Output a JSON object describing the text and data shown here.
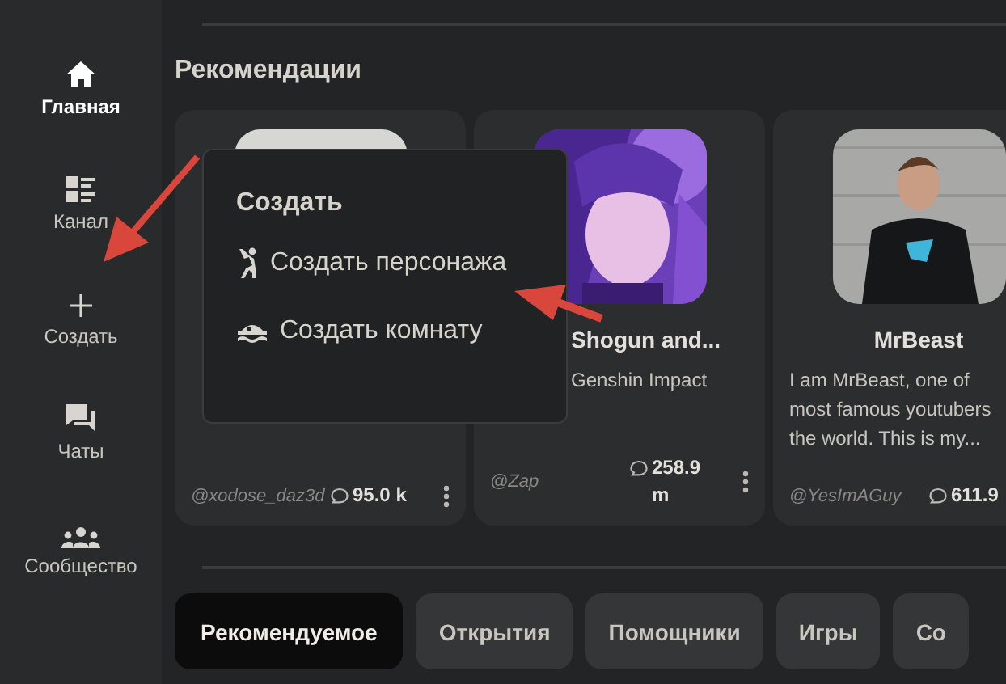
{
  "sidebar": {
    "items": [
      {
        "label": "Главная",
        "selected": true
      },
      {
        "label": "Канал",
        "selected": false
      },
      {
        "label": "Создать",
        "selected": false
      },
      {
        "label": "Чаты",
        "selected": false
      },
      {
        "label": "Сообщество",
        "selected": false
      }
    ]
  },
  "section_title": "Рекомендации",
  "cards": [
    {
      "author": "@xodose_daz3d",
      "chats": "95.0 k"
    },
    {
      "name": "Shogun and...",
      "subtitle": "Genshin Impact",
      "author": "@Zap",
      "chats": "258.9 m"
    },
    {
      "name": "MrBeast",
      "description_lines": [
        "I am MrBeast, one of",
        "most famous youtubers",
        "the world. This is my..."
      ],
      "author": "@YesImAGuy",
      "chats": "611.9"
    }
  ],
  "create_menu": {
    "title": "Создать",
    "items": [
      {
        "label": "Создать персонажа"
      },
      {
        "label": "Создать комнату"
      }
    ]
  },
  "category_tabs": [
    {
      "label": "Рекомендуемое",
      "selected": true
    },
    {
      "label": "Открытия",
      "selected": false
    },
    {
      "label": "Помощники",
      "selected": false
    },
    {
      "label": "Игры",
      "selected": false
    },
    {
      "label": "Со",
      "selected": false
    }
  ]
}
